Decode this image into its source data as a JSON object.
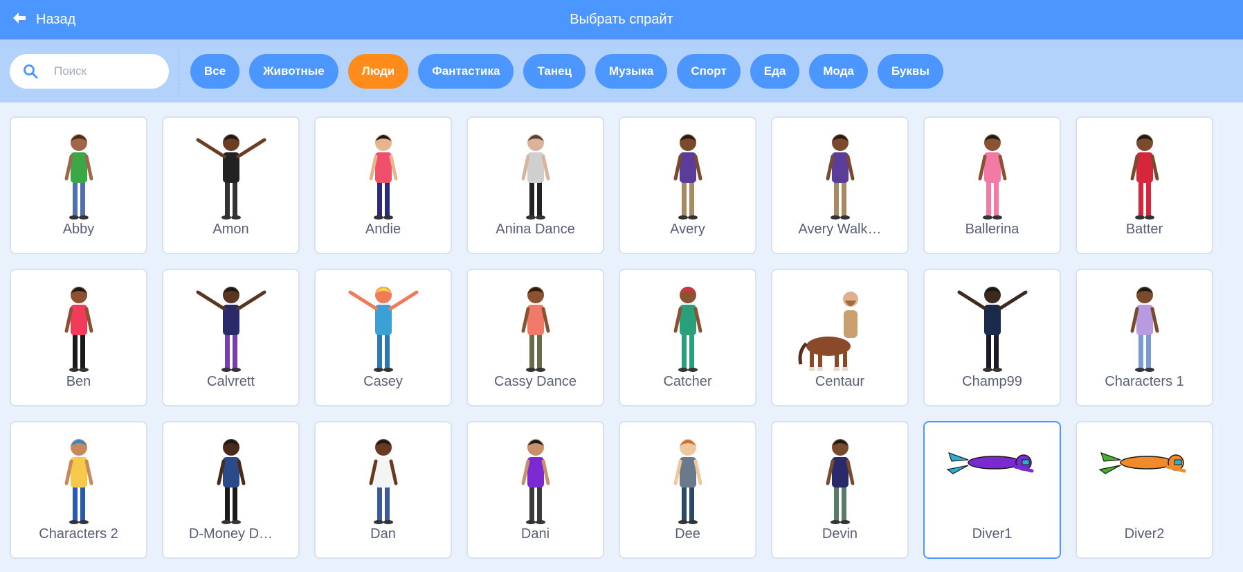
{
  "header": {
    "back_label": "Назад",
    "title": "Выбрать спрайт"
  },
  "search": {
    "placeholder": "Поиск",
    "value": ""
  },
  "tags": [
    {
      "label": "Все",
      "active": false
    },
    {
      "label": "Животные",
      "active": false
    },
    {
      "label": "Люди",
      "active": true
    },
    {
      "label": "Фантастика",
      "active": false
    },
    {
      "label": "Танец",
      "active": false
    },
    {
      "label": "Музыка",
      "active": false
    },
    {
      "label": "Спорт",
      "active": false
    },
    {
      "label": "Еда",
      "active": false
    },
    {
      "label": "Мода",
      "active": false
    },
    {
      "label": "Буквы",
      "active": false
    }
  ],
  "colors": {
    "header": "#4c97ff",
    "filterbar": "#b2d1fb",
    "tag": "#4c97ff",
    "tag_active": "#ff8c1a",
    "background": "#e9f1fc"
  },
  "sprites": [
    {
      "name": "Abby",
      "selected": false,
      "icon": "girl-green-shirt",
      "skin": "#a0664a",
      "shirt": "#3aa845",
      "pants": "#4f6fb0",
      "hair": "#4a2a14"
    },
    {
      "name": "Amon",
      "selected": false,
      "icon": "dancer-pose",
      "skin": "#6b3d22",
      "shirt": "#222222",
      "pants": "#333333",
      "hair": "#1a1a1a"
    },
    {
      "name": "Andie",
      "selected": false,
      "icon": "wheelchair-basketball",
      "skin": "#e8b48e",
      "shirt": "#ef4f6a",
      "pants": "#2b2b7a",
      "hair": "#1a1a1a"
    },
    {
      "name": "Anina Dance",
      "selected": false,
      "icon": "dancer-photo",
      "skin": "#d9b39a",
      "shirt": "#cfcfcf",
      "pants": "#222222",
      "hair": "#5a4030"
    },
    {
      "name": "Avery",
      "selected": false,
      "icon": "girl-purple",
      "skin": "#7a4a2c",
      "shirt": "#5b3d99",
      "pants": "#a78a63",
      "hair": "#2a1a10"
    },
    {
      "name": "Avery Walk…",
      "selected": false,
      "icon": "girl-walking",
      "skin": "#7a4a2c",
      "shirt": "#5b3d99",
      "pants": "#a78a63",
      "hair": "#2a1a10"
    },
    {
      "name": "Ballerina",
      "selected": false,
      "icon": "ballerina",
      "skin": "#8a5230",
      "shirt": "#f47aa6",
      "pants": "#f47aa6",
      "hair": "#1a1a1a"
    },
    {
      "name": "Batter",
      "selected": false,
      "icon": "baseball-batter",
      "skin": "#7a4a2c",
      "shirt": "#d6263c",
      "pants": "#d6263c",
      "hair": "#1a1a1a"
    },
    {
      "name": "Ben",
      "selected": false,
      "icon": "boy-running",
      "skin": "#8a5230",
      "shirt": "#f23a5a",
      "pants": "#1a1a1a",
      "hair": "#1a1a1a"
    },
    {
      "name": "Calvrett",
      "selected": false,
      "icon": "dancer-arms-up",
      "skin": "#5a3520",
      "shirt": "#2a2a6a",
      "pants": "#7a3db0",
      "hair": "#1a1a1a"
    },
    {
      "name": "Casey",
      "selected": false,
      "icon": "goalie-arms-wide",
      "skin": "#f07a5a",
      "shirt": "#3aa0d6",
      "pants": "#2a7ab0",
      "hair": "#ffd23a"
    },
    {
      "name": "Cassy Dance",
      "selected": false,
      "icon": "dancer-photo-female",
      "skin": "#8a5230",
      "shirt": "#f07a6a",
      "pants": "#6a6a4a",
      "hair": "#2a1a10"
    },
    {
      "name": "Catcher",
      "selected": false,
      "icon": "baseball-catcher",
      "skin": "#8a5230",
      "shirt": "#2aa07a",
      "pants": "#2aa07a",
      "hair": "#e02a4a"
    },
    {
      "name": "Centaur",
      "selected": false,
      "icon": "centaur",
      "skin": "#e0b090",
      "shirt": "#c8a070",
      "pants": "#8a4a2a",
      "hair": "#a06a3a"
    },
    {
      "name": "Champ99",
      "selected": false,
      "icon": "champ-arms-up",
      "skin": "#3a2a20",
      "shirt": "#1a2a4a",
      "pants": "#1a1a2a",
      "hair": "#1a1a1a"
    },
    {
      "name": "Characters 1",
      "selected": false,
      "icon": "girl-lavender",
      "skin": "#7a4a2c",
      "shirt": "#b89ae0",
      "pants": "#7a9ad0",
      "hair": "#1a1a1a"
    },
    {
      "name": "Characters 2",
      "selected": false,
      "icon": "girl-hijab",
      "skin": "#c8885a",
      "shirt": "#f8c84a",
      "pants": "#2a5ab0",
      "hair": "#2a8ad0"
    },
    {
      "name": "D-Money D…",
      "selected": false,
      "icon": "dancer-photo-male",
      "skin": "#4a2a1a",
      "shirt": "#2a4a8a",
      "pants": "#1a1a1a",
      "hair": "#1a1a1a"
    },
    {
      "name": "Dan",
      "selected": false,
      "icon": "man-white-shirt",
      "skin": "#6a3a20",
      "shirt": "#f4f4f4",
      "pants": "#3a5a9a",
      "hair": "#1a1a1a"
    },
    {
      "name": "Dani",
      "selected": false,
      "icon": "girl-purple-shirt",
      "skin": "#c8906a",
      "shirt": "#7a2ad0",
      "pants": "#3a3a3a",
      "hair": "#1a1a1a"
    },
    {
      "name": "Dee",
      "selected": false,
      "icon": "boy-grey-shirt",
      "skin": "#f0c8a0",
      "shirt": "#6a7a8a",
      "pants": "#2a4a6a",
      "hair": "#c8703a"
    },
    {
      "name": "Devin",
      "selected": false,
      "icon": "boy-sweater",
      "skin": "#7a4a2c",
      "shirt": "#2a2a6a",
      "pants": "#5a7a6a",
      "hair": "#1a1a1a"
    },
    {
      "name": "Diver1",
      "selected": true,
      "icon": "diver-purple",
      "skin": "#7a2ad0",
      "shirt": "#7a2ad0",
      "pants": "#2ab0d0",
      "hair": "#2ab0d0"
    },
    {
      "name": "Diver2",
      "selected": false,
      "icon": "diver-orange",
      "skin": "#f08a2a",
      "shirt": "#f08a2a",
      "pants": "#4ab02a",
      "hair": "#4ab02a"
    }
  ]
}
